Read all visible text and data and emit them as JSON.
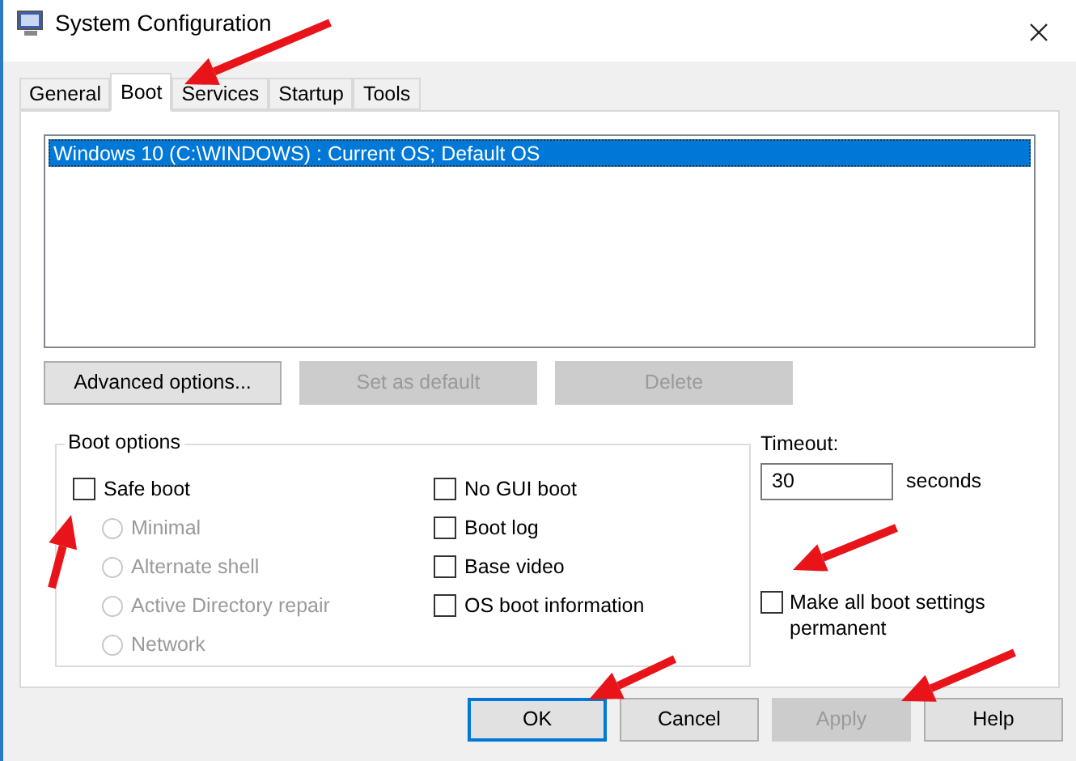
{
  "window": {
    "title": "System Configuration"
  },
  "tabs": [
    {
      "label": "General",
      "selected": false
    },
    {
      "label": "Boot",
      "selected": true
    },
    {
      "label": "Services",
      "selected": false
    },
    {
      "label": "Startup",
      "selected": false
    },
    {
      "label": "Tools",
      "selected": false
    }
  ],
  "os_list": [
    {
      "label": "Windows 10 (C:\\WINDOWS) : Current OS; Default OS",
      "selected": true
    }
  ],
  "list_buttons": [
    {
      "label": "Advanced options...",
      "disabled": false
    },
    {
      "label": "Set as default",
      "disabled": true
    },
    {
      "label": "Delete",
      "disabled": true
    }
  ],
  "boot_options": {
    "title": "Boot options",
    "left": [
      {
        "kind": "checkbox",
        "label": "Safe boot",
        "checked": false,
        "disabled": false
      },
      {
        "kind": "radio",
        "label": "Minimal",
        "selected": false,
        "disabled": true
      },
      {
        "kind": "radio",
        "label": "Alternate shell",
        "selected": false,
        "disabled": true
      },
      {
        "kind": "radio",
        "label": "Active Directory repair",
        "selected": false,
        "disabled": true
      },
      {
        "kind": "radio",
        "label": "Network",
        "selected": false,
        "disabled": true
      }
    ],
    "right": [
      {
        "kind": "checkbox",
        "label": "No GUI boot",
        "checked": false,
        "disabled": false
      },
      {
        "kind": "checkbox",
        "label": "Boot log",
        "checked": false,
        "disabled": false
      },
      {
        "kind": "checkbox",
        "label": "Base video",
        "checked": false,
        "disabled": false
      },
      {
        "kind": "checkbox",
        "label": "OS boot information",
        "checked": false,
        "disabled": false
      }
    ]
  },
  "timeout": {
    "label": "Timeout:",
    "value": "30",
    "unit": "seconds"
  },
  "permanent": {
    "label": "Make all boot settings permanent",
    "checked": false
  },
  "dialog_buttons": [
    {
      "label": "OK",
      "disabled": false,
      "default": true
    },
    {
      "label": "Cancel",
      "disabled": false,
      "default": false
    },
    {
      "label": "Apply",
      "disabled": true,
      "default": false
    },
    {
      "label": "Help",
      "disabled": false,
      "default": false
    }
  ]
}
